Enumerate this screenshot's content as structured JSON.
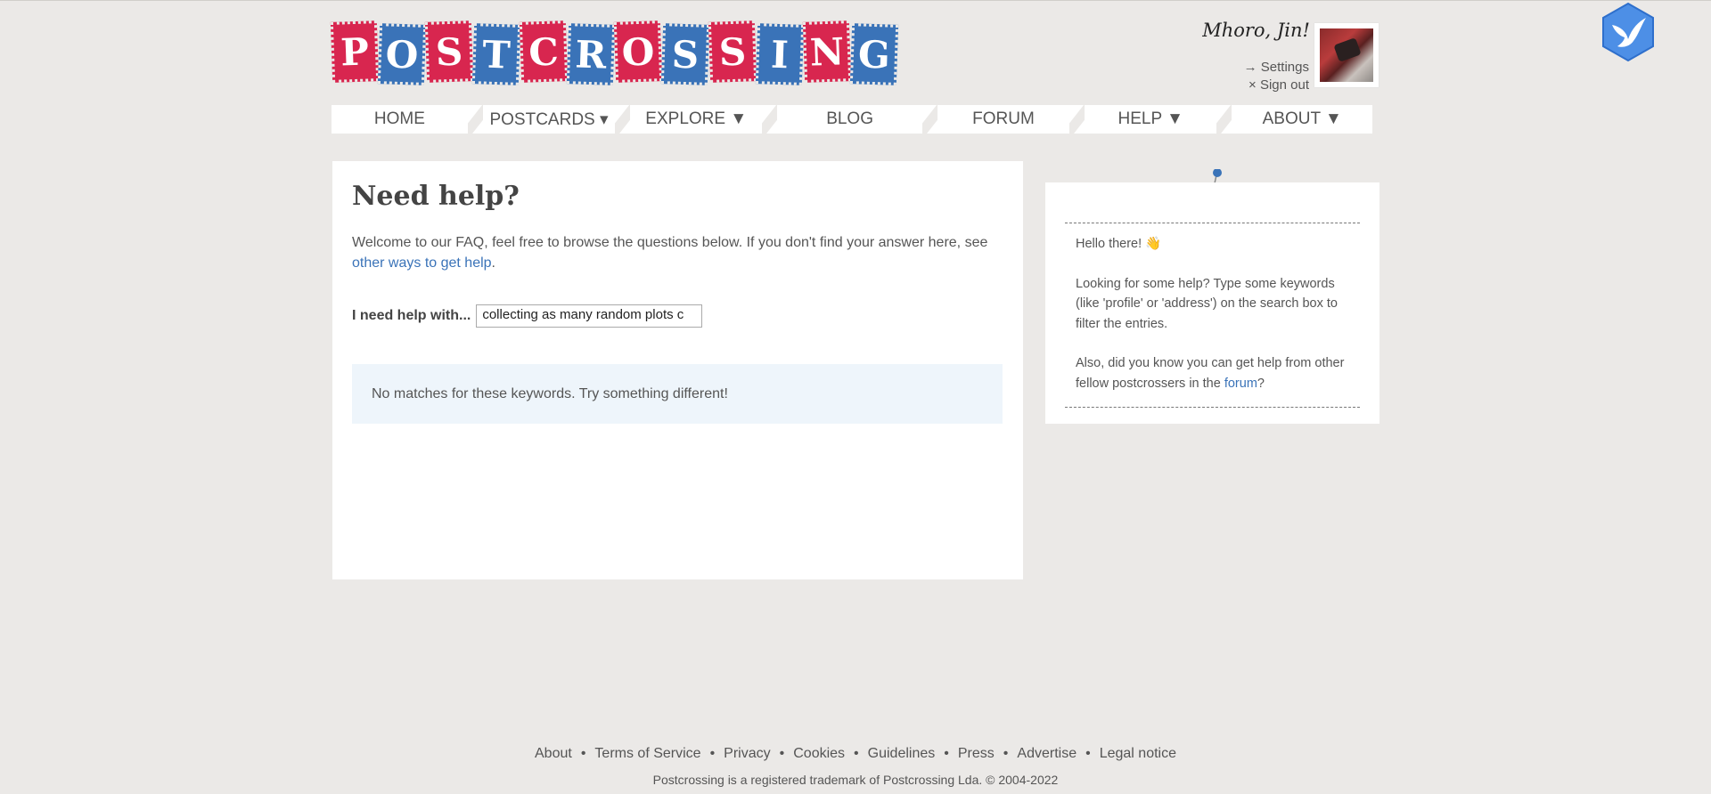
{
  "brand": {
    "logo_letters": [
      "P",
      "O",
      "S",
      "T",
      "C",
      "R",
      "O",
      "S",
      "S",
      "I",
      "N",
      "G"
    ]
  },
  "user": {
    "greeting": "Mhoro, Jin!",
    "settings_label": "→ Settings",
    "signout_label": "× Sign out"
  },
  "nav": {
    "items": [
      {
        "label": "HOME"
      },
      {
        "label": "POSTCARDS ▾"
      },
      {
        "label": "EXPLORE ▼"
      },
      {
        "label": "BLOG"
      },
      {
        "label": "FORUM"
      },
      {
        "label": "HELP ▼"
      },
      {
        "label": "ABOUT ▼"
      }
    ]
  },
  "main": {
    "title": "Need help?",
    "intro_text": "Welcome to our FAQ, feel free to browse the questions below. If you don't find your answer here, see ",
    "intro_link": "other ways to get help",
    "intro_end": ".",
    "help_label": "I need help with...",
    "search_value": "collecting as many random plots c",
    "no_match_text": "No matches for these keywords. Try something different!"
  },
  "sidebar": {
    "hello": "Hello there! 👋",
    "tip": "Looking for some help? Type some keywords (like 'profile' or 'address') on the search box to filter the entries.",
    "forum_text": "Also, did you know you can get help from other fellow postcrossers in the ",
    "forum_link": "forum",
    "forum_end": "?"
  },
  "footer": {
    "links": [
      "About",
      "Terms of Service",
      "Privacy",
      "Cookies",
      "Guidelines",
      "Press",
      "Advertise",
      "Legal notice"
    ],
    "separator": "•",
    "copyright": "Postcrossing is a registered trademark of Postcrossing Lda. © 2004-2022"
  },
  "colors": {
    "background": "#ebe9e7",
    "stamp_red": "#d8264f",
    "stamp_blue": "#3a73b8",
    "link": "#3a73b8",
    "notice_bg": "#eef5fb"
  }
}
